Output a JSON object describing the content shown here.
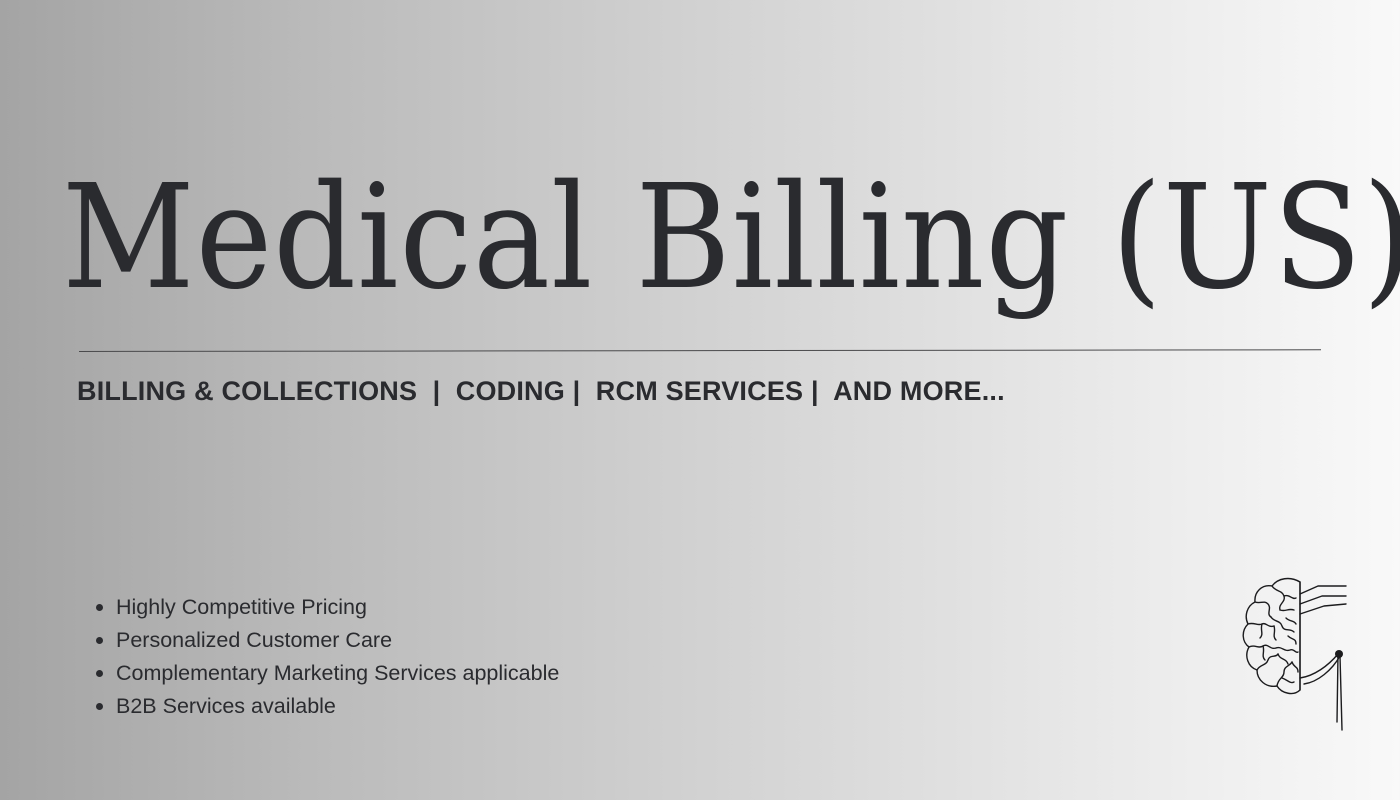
{
  "title": "Medical Billing (US)",
  "services_line": "BILLING & COLLECTIONS  |  CODING |  RCM SERVICES |  AND MORE...",
  "features": [
    "Highly Competitive Pricing",
    "Personalized Customer Care",
    "Complementary Marketing Services applicable",
    "B2B Services available"
  ],
  "logo": {
    "icon": "brain-circuit-icon"
  },
  "colors": {
    "text": "#2a2b2f",
    "gradient_start": "#a4a4a4",
    "gradient_end": "#f9f9f9"
  }
}
